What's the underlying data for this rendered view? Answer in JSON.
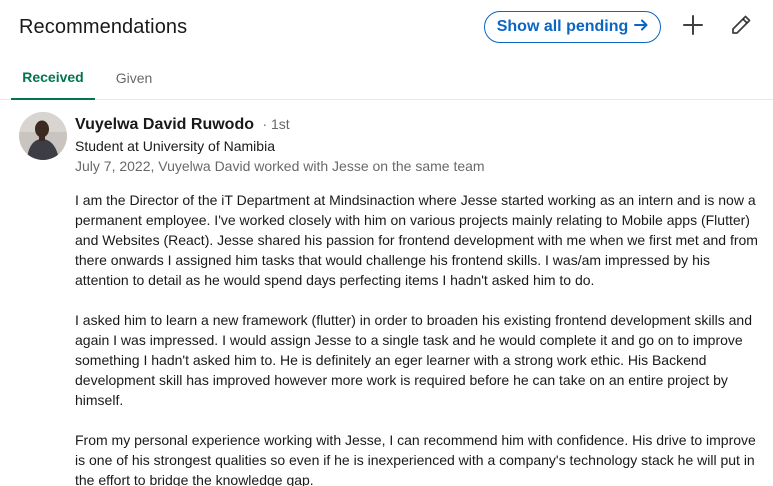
{
  "header": {
    "title": "Recommendations",
    "show_pending_label": "Show all pending",
    "show_pending_icon": "arrow-right-icon",
    "add_icon": "plus-icon",
    "edit_icon": "pencil-icon"
  },
  "tabs": [
    {
      "label": "Received",
      "active": true
    },
    {
      "label": "Given",
      "active": false
    }
  ],
  "colors": {
    "accent": "#0a66c2",
    "tab_active": "#01754f"
  },
  "recommendation": {
    "name": "Vuyelwa David Ruwodo",
    "degree": "· 1st",
    "headline": "Student at University of Namibia",
    "meta": "July 7, 2022, Vuyelwa David worked with Jesse on the same team",
    "paragraphs": [
      "I am the Director of the iT Department at Mindsinaction where Jesse started working as an intern and is now a permanent employee. I've worked closely with him on various projects mainly relating to Mobile apps (Flutter) and Websites (React). Jesse shared his passion for frontend development with me when we first met and from there onwards I assigned him tasks that would challenge his frontend skills. I was/am impressed by his attention to detail as he would spend days perfecting items I hadn't asked him to do.",
      "I asked him to learn a new framework (flutter) in order to broaden his existing frontend development skills and again I was impressed. I would assign Jesse to a single task and he would complete it and go on to improve something I hadn't asked him to. He is definitely an eger learner with a strong work ethic. His Backend development skill has improved however more work is required before he can take on an entire project by himself.",
      "From my personal experience working with Jesse, I can recommend him with confidence. His drive to improve is one of his strongest qualities so even if he is inexperienced with a company's technology stack he will put in the effort to bridge the knowledge gap."
    ]
  }
}
